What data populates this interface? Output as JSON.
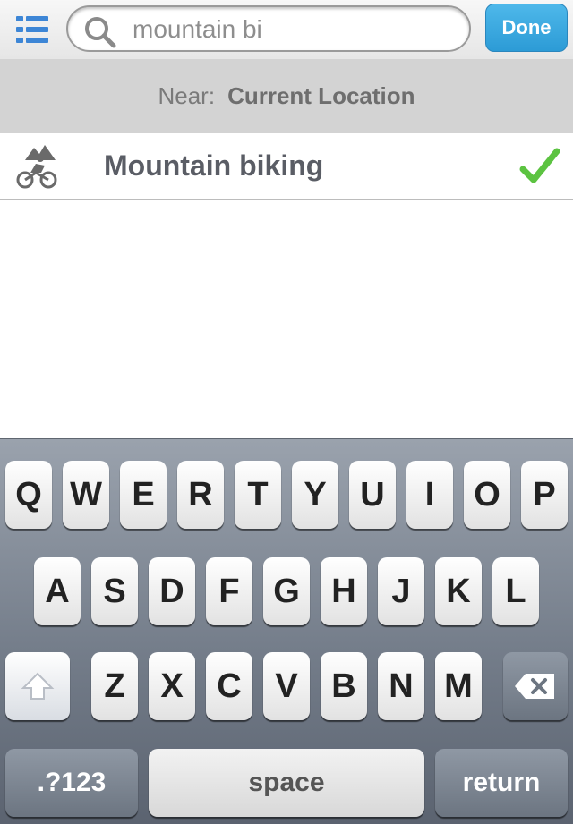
{
  "search": {
    "value": "mountain bi",
    "done_label": "Done"
  },
  "location": {
    "near_label": "Near:",
    "near_value": "Current Location"
  },
  "results": [
    {
      "label": "Mountain biking",
      "selected": true
    }
  ],
  "keyboard": {
    "row1": [
      "Q",
      "W",
      "E",
      "R",
      "T",
      "Y",
      "U",
      "I",
      "O",
      "P"
    ],
    "row2": [
      "A",
      "S",
      "D",
      "F",
      "G",
      "H",
      "J",
      "K",
      "L"
    ],
    "row3": [
      "Z",
      "X",
      "C",
      "V",
      "B",
      "N",
      "M"
    ],
    "numbers_label": ".?123",
    "space_label": "space",
    "return_label": "return"
  },
  "colors": {
    "accent": "#2c9bd6",
    "check": "#5cc341",
    "icon_blue": "#3d86d6"
  }
}
